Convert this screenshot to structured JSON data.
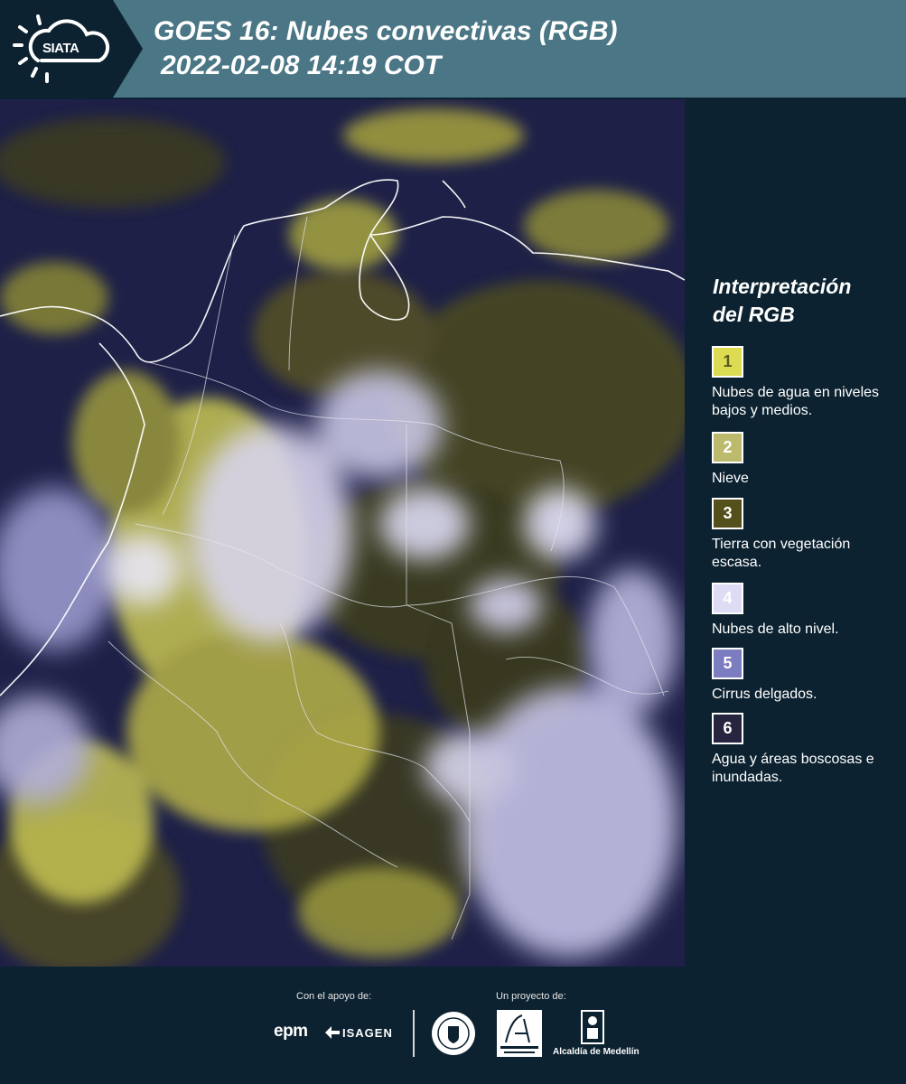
{
  "header": {
    "logo_text": "SIATA",
    "title_line1": "GOES 16: Nubes convectivas (RGB)",
    "title_line2": "2022-02-08 14:19 COT"
  },
  "map": {
    "icon": "satellite-composite-image"
  },
  "legend": {
    "title_line1": "Interpretación",
    "title_line2": "del RGB",
    "items": [
      {
        "number": "1",
        "label": "Nubes de agua en niveles bajos y medios.",
        "color": "#dcdb52",
        "text_color": "#5a5a20"
      },
      {
        "number": "2",
        "label": "Nieve",
        "color": "#bcba6d",
        "text_color": "#ffffff"
      },
      {
        "number": "3",
        "label": "Tierra con vegetación escasa.",
        "color": "#54501c",
        "text_color": "#ffffff"
      },
      {
        "number": "4",
        "label": "Nubes de alto nivel.",
        "color": "#dcdcf4",
        "text_color": "#ffffff"
      },
      {
        "number": "5",
        "label": "Cirrus delgados.",
        "color": "#7c7cc0",
        "text_color": "#ffffff"
      },
      {
        "number": "6",
        "label": "Agua y áreas boscosas e inundadas.",
        "color": "#252540",
        "text_color": "#ffffff"
      }
    ]
  },
  "footer": {
    "support_label": "Con el apoyo de:",
    "project_label": "Un proyecto de:",
    "epm": "epm",
    "isagen": "ISAGEN",
    "alcaldia": "Alcaldía de Medellín"
  }
}
